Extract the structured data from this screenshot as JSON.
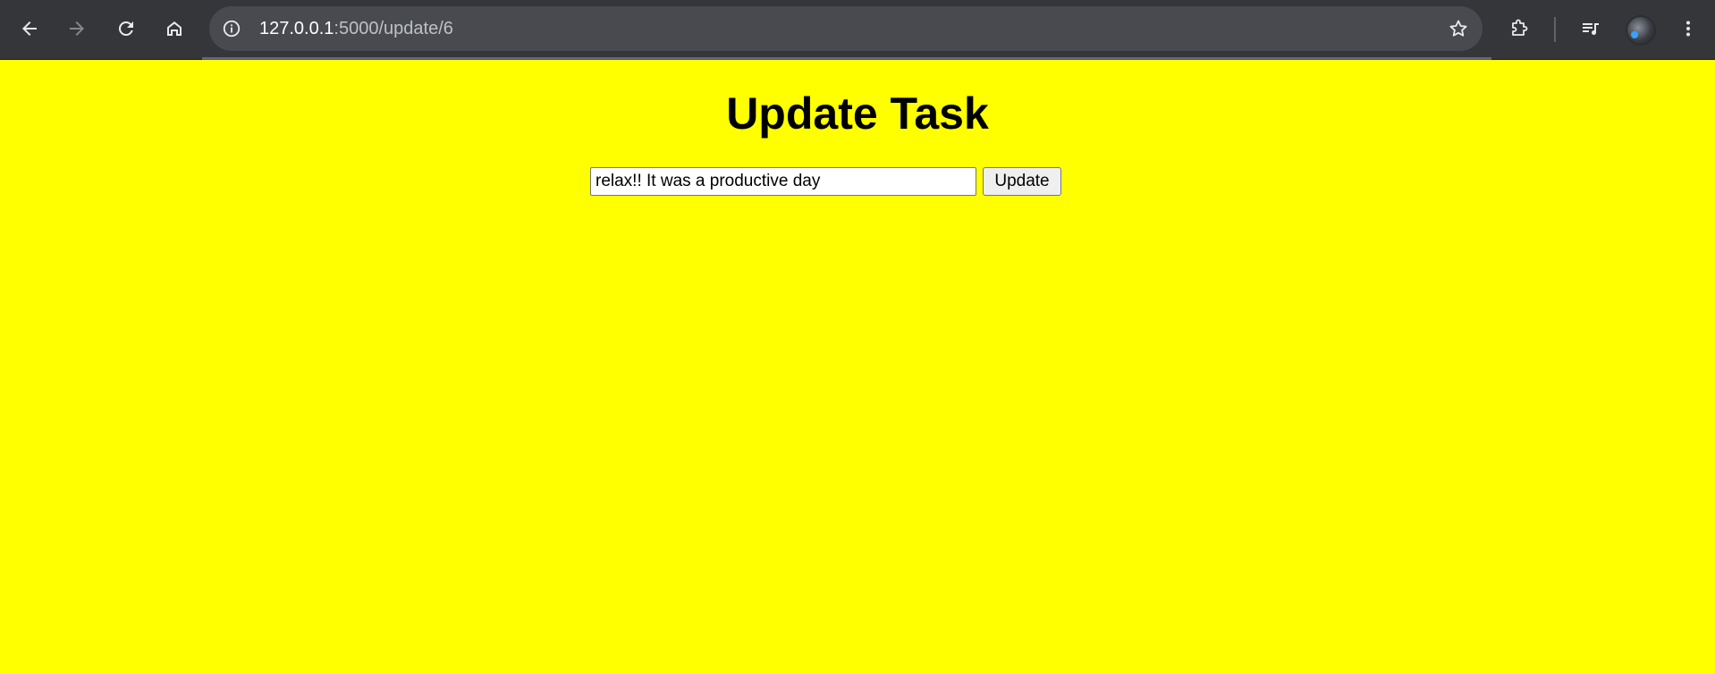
{
  "browser": {
    "url_host": "127.0.0.1",
    "url_path": ":5000/update/6",
    "icons": {
      "back": "back-arrow-icon",
      "forward": "forward-arrow-icon",
      "reload": "reload-icon",
      "home": "home-icon",
      "site_info": "info-icon",
      "bookmark": "star-icon",
      "extensions": "puzzle-icon",
      "media": "media-control-icon",
      "profile": "avatar",
      "menu": "kebab-menu-icon"
    },
    "colors": {
      "toolbar": "#35363a",
      "omnibox": "#484a4f"
    }
  },
  "page": {
    "title": "Update Task",
    "background": "#ffff00",
    "task_input_value": "relax!! It was a productive day",
    "update_label": "Update"
  }
}
